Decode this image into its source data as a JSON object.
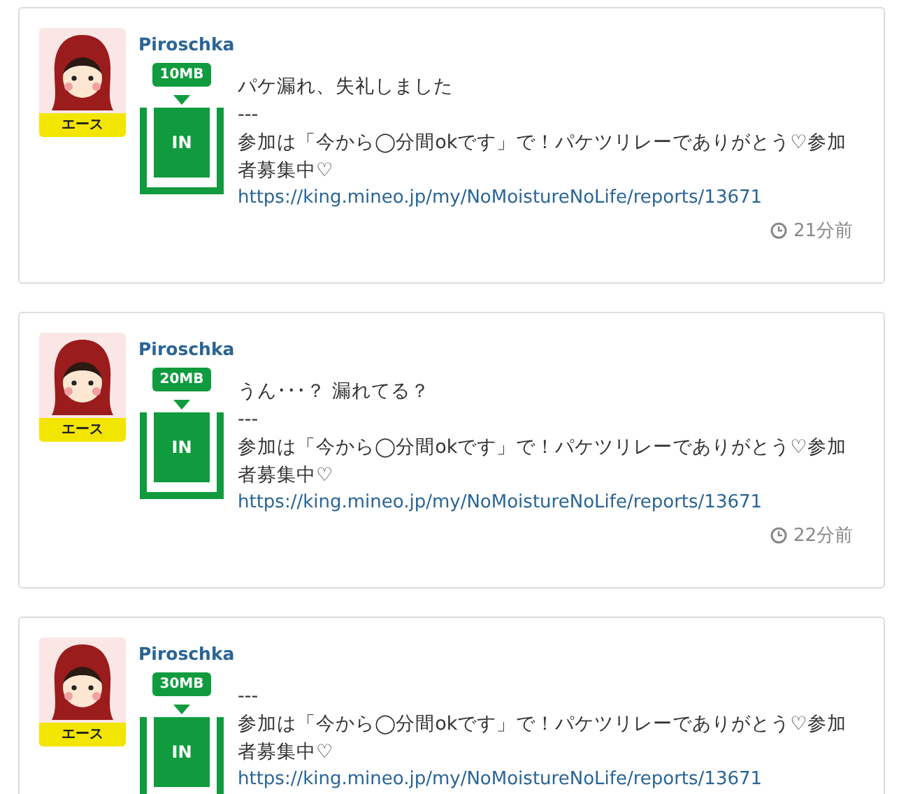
{
  "posts": [
    {
      "user": "Piroschka",
      "rank": "エース",
      "amount": "10MB",
      "action": "IN",
      "message": "パケ漏れ、失礼しました",
      "separator": "---",
      "body": "参加は「今から◯分間okです」で！パケツリレーでありがとう♡参加者募集中♡",
      "link": "https://king.mineo.jp/my/NoMoistureNoLife/reports/13671",
      "time": "21分前"
    },
    {
      "user": "Piroschka",
      "rank": "エース",
      "amount": "20MB",
      "action": "IN",
      "message": "うん･･･？ 漏れてる？",
      "separator": "---",
      "body": "参加は「今から◯分間okです」で！パケツリレーでありがとう♡参加者募集中♡",
      "link": "https://king.mineo.jp/my/NoMoistureNoLife/reports/13671",
      "time": "22分前"
    },
    {
      "user": "Piroschka",
      "rank": "エース",
      "amount": "30MB",
      "action": "IN",
      "separator": "---",
      "body": "参加は「今から◯分間okです」で！パケツリレーでありがとう♡参加者募集中♡",
      "link": "https://king.mineo.jp/my/NoMoistureNoLife/reports/13671"
    }
  ]
}
